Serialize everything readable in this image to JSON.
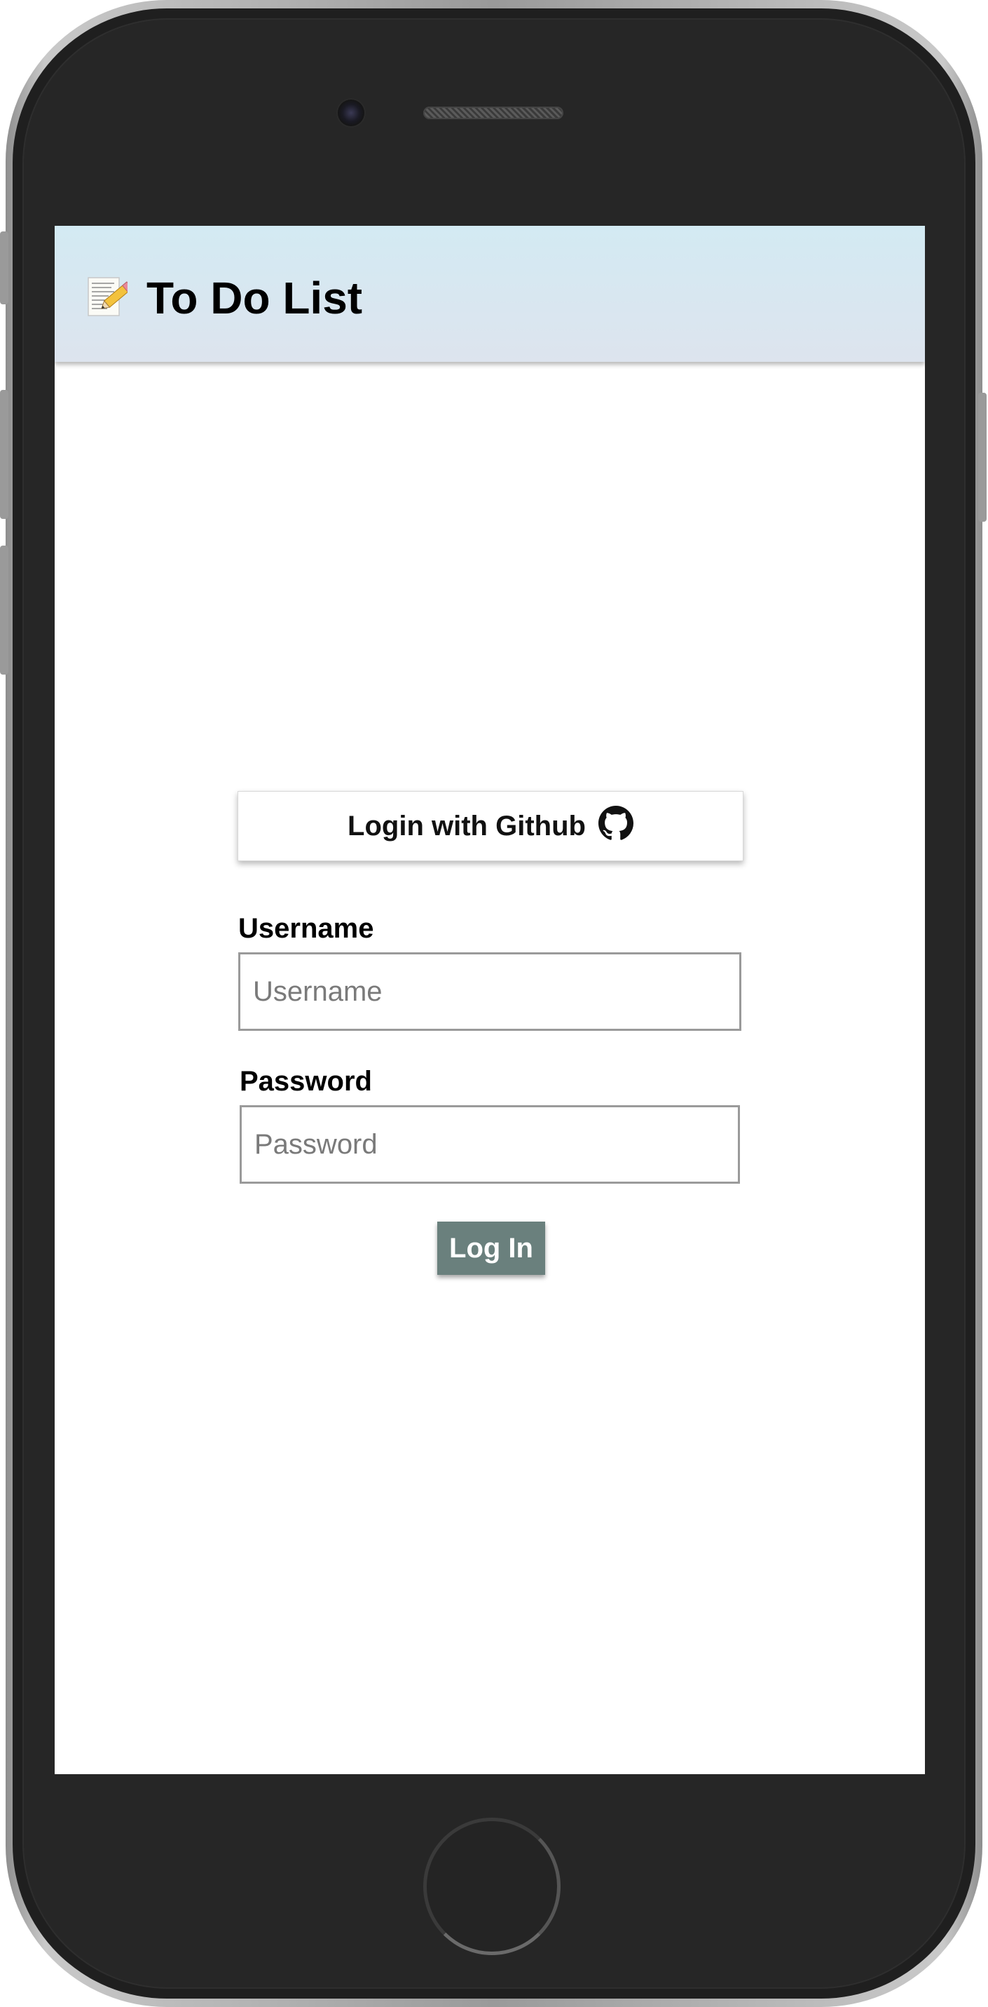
{
  "header": {
    "emoji_icon": "memo-icon",
    "title": "To Do List"
  },
  "github_login": {
    "label": "Login with Github",
    "icon": "github-icon"
  },
  "form": {
    "username_label": "Username",
    "username_placeholder": "Username",
    "username_value": "",
    "password_label": "Password",
    "password_placeholder": "Password",
    "password_value": "",
    "submit_label": "Log In"
  },
  "colors": {
    "header_bg": "#d3eaf3",
    "submit_bg": "#6a807d",
    "submit_text": "#ffffff"
  }
}
